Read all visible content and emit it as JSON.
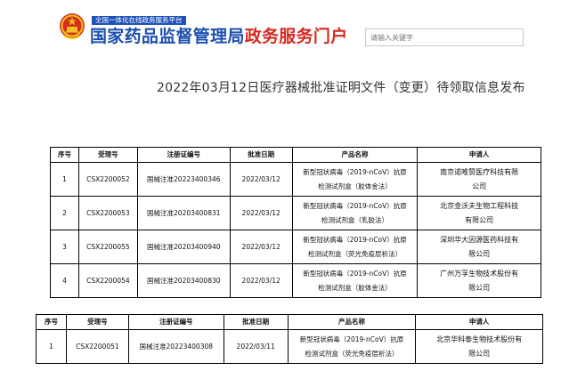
{
  "header": {
    "portal_strip": "全国一体化在线政务服务平台",
    "title_blue": "国家药品监督管理局",
    "title_red": "政务服务门户",
    "search_placeholder": "请输入关键字",
    "emblem_icon": "national-emblem-icon"
  },
  "page_title": "2022年03月12日医疗器械批准证明文件（变更）待领取信息发布",
  "table_columns": [
    "序号",
    "受理号",
    "注册证编号",
    "批准日期",
    "产品名称",
    "申请人"
  ],
  "table1": {
    "rows": [
      {
        "no": "1",
        "accept": "CSX2200052",
        "cert": "国械注准20223400346",
        "date": "2022/03/12",
        "product_l1": "新型冠状病毒（2019-nCoV）抗原",
        "product_l2": "检测试剂盒（胶体金法）",
        "applicant_l1": "南京诺唯赞医疗科技有限",
        "applicant_l2": "公司"
      },
      {
        "no": "2",
        "accept": "CSX2200053",
        "cert": "国械注准20203400831",
        "date": "2022/03/12",
        "product_l1": "新型冠状病毒（2019-nCoV）抗原",
        "product_l2": "检测试剂盒（乳胶法）",
        "applicant_l1": "北京金沃夫生物工程科技",
        "applicant_l2": "有限公司"
      },
      {
        "no": "3",
        "accept": "CSX2200055",
        "cert": "国械注准20203400940",
        "date": "2022/03/12",
        "product_l1": "新型冠状病毒（2019-nCoV）抗原",
        "product_l2": "检测试剂盒（荧光免疫层析法）",
        "applicant_l1": "深圳华大因源医药科技有",
        "applicant_l2": "限公司"
      },
      {
        "no": "4",
        "accept": "CSX2200054",
        "cert": "国械注准20203400830",
        "date": "2022/03/12",
        "product_l1": "新型冠状病毒（2019-nCoV）抗原",
        "product_l2": "检测试剂盒（胶体金法）",
        "applicant_l1": "广州万孚生物技术股份有",
        "applicant_l2": "限公司"
      }
    ]
  },
  "table2": {
    "rows": [
      {
        "no": "1",
        "accept": "CSX2200051",
        "cert": "国械注准20223400308",
        "date": "2022/03/11",
        "product_l1": "新型冠状病毒（2019-nCoV）抗原",
        "product_l2": "检测试剂盒（荧光免疫层析法）",
        "applicant_l1": "北京华科泰生物技术股份有",
        "applicant_l2": "限公司"
      }
    ]
  }
}
